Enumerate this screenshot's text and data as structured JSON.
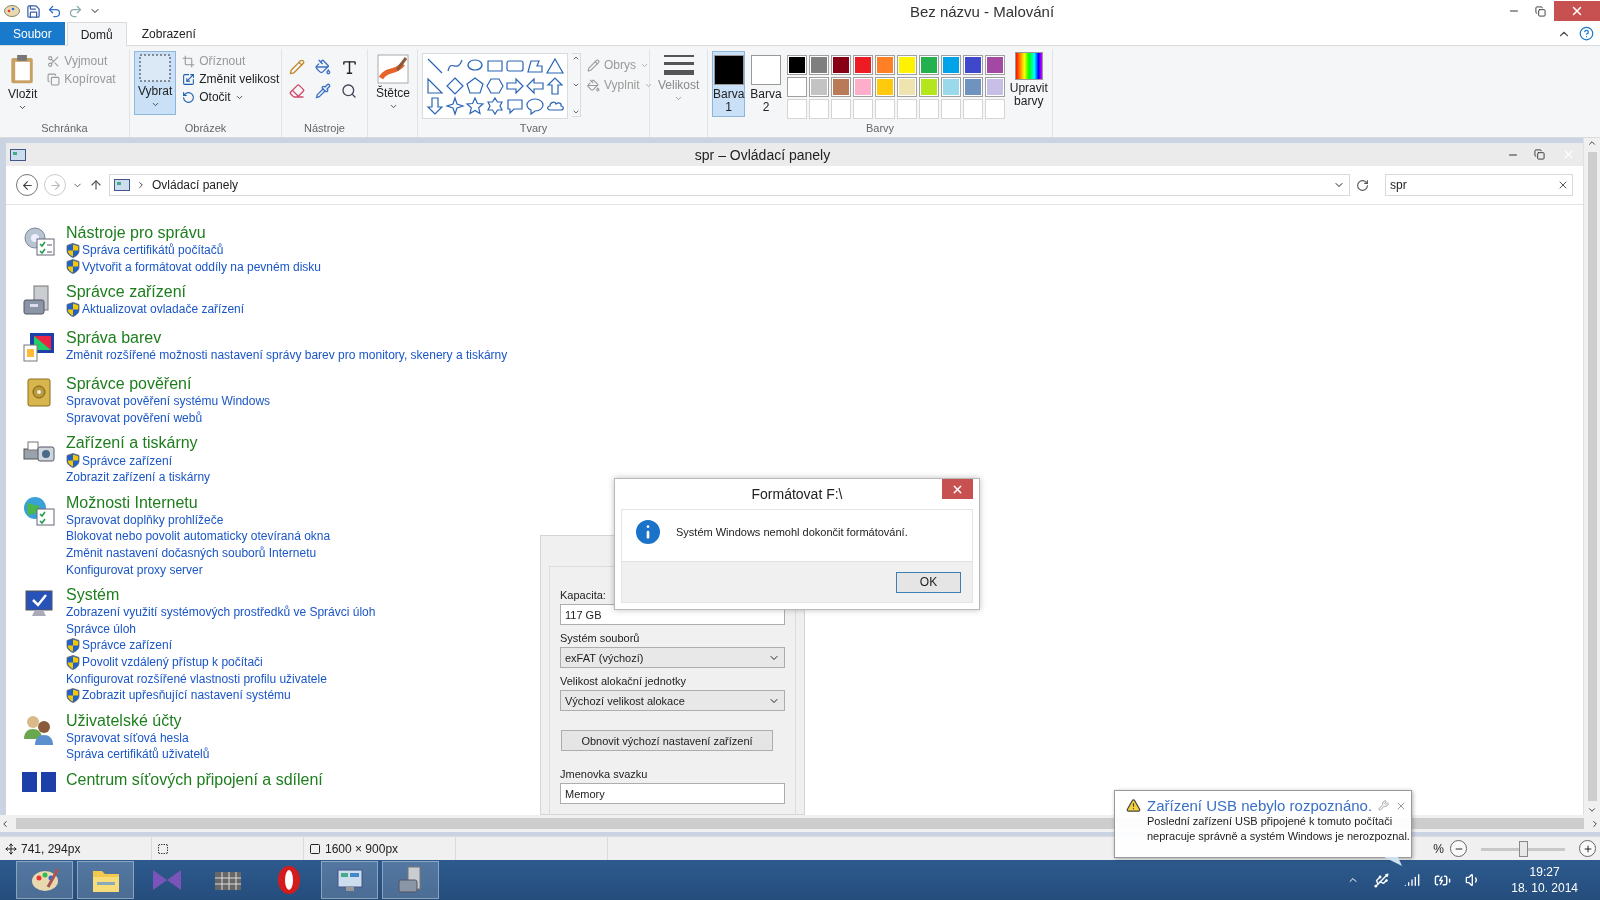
{
  "window": {
    "title": "Bez názvu - Malování"
  },
  "ribbon_tabs": [
    {
      "label": "Soubor",
      "kind": "file",
      "selected": false
    },
    {
      "label": "Domů",
      "kind": "tab",
      "selected": true
    },
    {
      "label": "Zobrazení",
      "kind": "tab",
      "selected": false
    }
  ],
  "ribbon": {
    "clipboard": {
      "label": "Schránka",
      "paste": "Vložit",
      "cut": "Vyjmout",
      "copy": "Kopírovat"
    },
    "image": {
      "label": "Obrázek",
      "select": "Vybrat",
      "crop": "Oříznout",
      "resize": "Změnit velikost",
      "rotate": "Otočit"
    },
    "tools": {
      "label": "Nástroje"
    },
    "brushes": "Štětce",
    "shapes": {
      "label": "Tvary",
      "outline": "Obrys",
      "fill": "Vyplnit"
    },
    "size": "Velikost",
    "color_slots": [
      {
        "label": "Barva",
        "number": "1",
        "color": "#000000",
        "selected": true
      },
      {
        "label": "Barva",
        "number": "2",
        "color": "#ffffff",
        "selected": false
      }
    ],
    "colors": {
      "label": "Barvy",
      "edit": "Upravit barvy",
      "palette": [
        {
          "color": "#000000"
        },
        {
          "color": "#7f7f7f"
        },
        {
          "color": "#880015"
        },
        {
          "color": "#ed1c24"
        },
        {
          "color": "#ff7f27"
        },
        {
          "color": "#fff200"
        },
        {
          "color": "#22b14c"
        },
        {
          "color": "#00a2e8"
        },
        {
          "color": "#3f48cc"
        },
        {
          "color": "#a349a4"
        },
        {
          "color": "#ffffff"
        },
        {
          "color": "#c3c3c3"
        },
        {
          "color": "#b97a57"
        },
        {
          "color": "#ffaec9"
        },
        {
          "color": "#ffc90e"
        },
        {
          "color": "#efe4b0"
        },
        {
          "color": "#b5e61d"
        },
        {
          "color": "#99d9ea"
        },
        {
          "color": "#7092be"
        },
        {
          "color": "#c8bfe7"
        }
      ]
    }
  },
  "control_panel": {
    "title": "spr – Ovládací panely",
    "path": "Ovládací panely",
    "search": "spr",
    "results": [
      {
        "kind": "tools",
        "title": "Nástroje pro správu",
        "links": [
          {
            "text": "Správa certifikátů počítačů",
            "shield": true
          },
          {
            "text": "Vytvořit a formátovat oddíly na pevném disku",
            "shield": true
          }
        ]
      },
      {
        "kind": "devices",
        "title": "Správce zařízení",
        "links": [
          {
            "text": "Aktualizovat ovladače zařízení",
            "shield": true
          }
        ]
      },
      {
        "kind": "color",
        "title": "Správa barev",
        "links": [
          {
            "text": "Změnit rozšířené možnosti nastavení správy barev pro monitory, skenery a tiskárny",
            "shield": false
          }
        ]
      },
      {
        "kind": "credentials",
        "title": "Správce pověření",
        "links": [
          {
            "text": "Spravovat pověření systému Windows",
            "shield": false
          },
          {
            "text": "Spravovat pověření webů",
            "shield": false
          }
        ]
      },
      {
        "kind": "printers",
        "title": "Zařízení a tiskárny",
        "links": [
          {
            "text": "Správce zařízení",
            "shield": true
          },
          {
            "text": "Zobrazit zařízení a tiskárny",
            "shield": false
          }
        ]
      },
      {
        "kind": "internet",
        "title": "Možnosti Internetu",
        "links": [
          {
            "text": "Spravovat doplňky prohlížeče",
            "shield": false
          },
          {
            "text": "Blokovat nebo povolit automaticky otevíraná okna",
            "shield": false
          },
          {
            "text": "Změnit nastavení dočasných souborů Internetu",
            "shield": false
          },
          {
            "text": "Konfigurovat proxy server",
            "shield": false
          }
        ]
      },
      {
        "kind": "system",
        "title": "Systém",
        "links": [
          {
            "text": "Zobrazení využití systémových prostředků ve Správci úloh",
            "shield": false
          },
          {
            "text": "Správce úloh",
            "shield": false
          },
          {
            "text": "Správce zařízení",
            "shield": true
          },
          {
            "text": "Povolit vzdálený přístup k počítači",
            "shield": true
          },
          {
            "text": "Konfigurovat rozšířené vlastnosti profilu uživatele",
            "shield": false
          },
          {
            "text": "Zobrazit upřesňující nastavení systému",
            "shield": true
          }
        ]
      },
      {
        "kind": "users",
        "title": "Uživatelské účty",
        "links": [
          {
            "text": "Spravovat síťová hesla",
            "shield": false
          },
          {
            "text": "Správa certifikátů uživatelů",
            "shield": false
          }
        ]
      },
      {
        "kind": "network",
        "title": "Centrum síťových připojení a sdílení"
      }
    ]
  },
  "format_dialog": {
    "capacity_label": "Kapacita:",
    "capacity": "117 GB",
    "fs_label": "Systém souborů",
    "fs": "exFAT (výchozí)",
    "alloc_label": "Velikost alokační jednotky",
    "alloc": "Výchozí velikost alokace",
    "restore": "Obnovit výchozí nastavení zařízení",
    "volume_label": "Jmenovka svazku",
    "volume": "Memory"
  },
  "message_box": {
    "title": "Formátovat F:\\",
    "message": "Systém Windows nemohl dokončit formátování.",
    "ok": "OK"
  },
  "status_bar": {
    "cursor": "741, 294px",
    "canvas_size": "1600 × 900px",
    "zoom": "%",
    "zoom_slider": {
      "level": 0.5
    }
  },
  "taskbar": {
    "apps": [
      {
        "kind": "paint",
        "active": true
      },
      {
        "kind": "explorer",
        "active": true
      },
      {
        "kind": "vs",
        "active": false
      },
      {
        "kind": "grid",
        "active": false
      },
      {
        "kind": "opera",
        "active": false
      },
      {
        "kind": "cpanel",
        "active": true
      },
      {
        "kind": "devmgr",
        "active": true
      }
    ],
    "time": "19:27",
    "date": "18. 10. 2014"
  },
  "notification": {
    "title": "Zařízení USB nebylo rozpoznáno.",
    "body": "Poslední zařízení USB připojené k tomuto počítači nepracuje správně a systém Windows je nerozpoznal."
  }
}
